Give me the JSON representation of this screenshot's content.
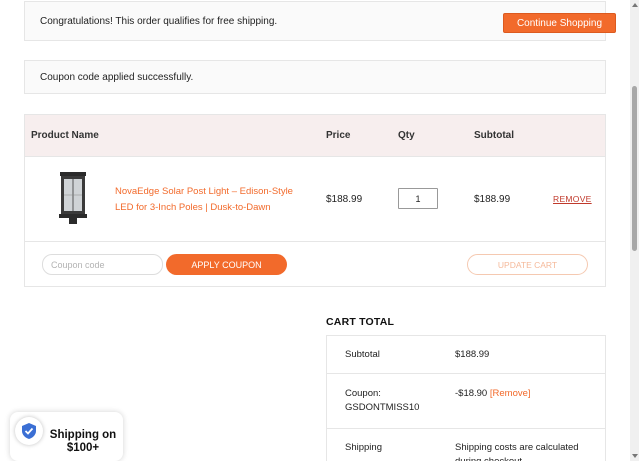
{
  "notices": {
    "shipping": "Congratulations! This order qualifies for free shipping.",
    "continue_button": "Continue Shopping",
    "coupon_applied": "Coupon code applied successfully."
  },
  "cart_table": {
    "headers": {
      "product_name": "Product Name",
      "price": "Price",
      "qty": "Qty",
      "subtotal": "Subtotal"
    },
    "items": [
      {
        "name": "NovaEdge Solar Post Light – Edison-Style LED for 3-Inch Poles | Dusk-to-Dawn",
        "price": "$188.99",
        "qty": "1",
        "subtotal": "$188.99",
        "remove_label": "REMOVE"
      }
    ],
    "coupon_placeholder": "Coupon code",
    "apply_coupon": "APPLY COUPON",
    "update_cart": "UPDATE CART"
  },
  "cart_total": {
    "title": "CART TOTAL",
    "subtotal_label": "Subtotal",
    "subtotal_value": "$188.99",
    "coupon_label": "Coupon:",
    "coupon_code": "GSDONTMISS10",
    "coupon_value": "-$18.90",
    "coupon_remove": "[Remove]",
    "shipping_label": "Shipping",
    "shipping_value": "Shipping costs are calculated during checkout."
  },
  "badge": {
    "text": "Shipping on $100+",
    "icon": "shield-check-icon"
  },
  "colors": {
    "accent": "#f26a2b",
    "header_bg": "#f7eeee",
    "remove_link": "#c0392b"
  }
}
